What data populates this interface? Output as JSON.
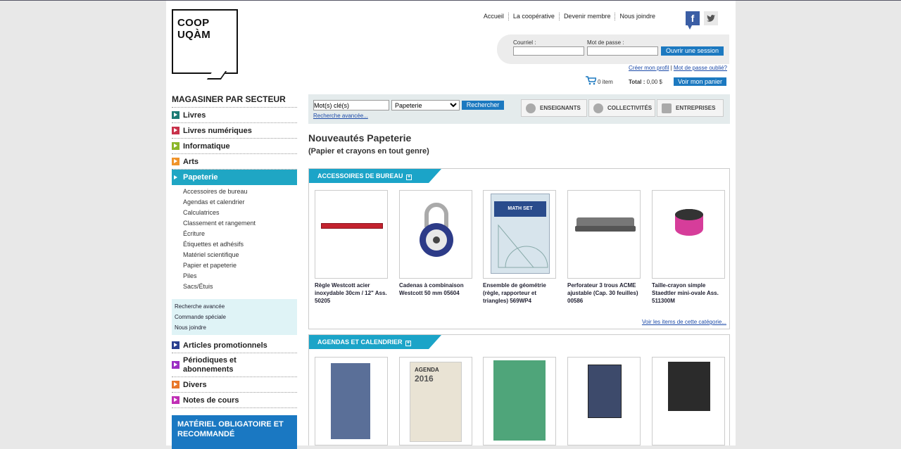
{
  "logo": {
    "line1": "COOP",
    "line2": "UQÀM"
  },
  "topnav": [
    "Accueil",
    "La coopérative",
    "Devenir membre",
    "Nous joindre"
  ],
  "social": {
    "facebook": "f",
    "twitter": "t"
  },
  "login": {
    "email_label": "Courriel :",
    "password_label": "Mot de passe :",
    "submit": "Ouvrir une session"
  },
  "account": {
    "create": "Créer mon profil",
    "sep": "|",
    "forgot": "Mot de passe oublié?"
  },
  "cart": {
    "items": "0 item",
    "total_label": "Total :",
    "total_value": "0,00 $",
    "view": "Voir mon panier"
  },
  "sidebar": {
    "title": "MAGASINER PAR SECTEUR",
    "categories": [
      {
        "label": "Livres",
        "color": "#1c7b74"
      },
      {
        "label": "Livres numériques",
        "color": "#c8314a"
      },
      {
        "label": "Informatique",
        "color": "#8cb629"
      },
      {
        "label": "Arts",
        "color": "#f0942a"
      },
      {
        "label": "Papeterie",
        "color": "#1fa6c4"
      }
    ],
    "subcategories": [
      "Accessoires de bureau",
      "Agendas et calendrier",
      "Calculatrices",
      "Classement et rangement",
      "Écriture",
      "Étiquettes et adhésifs",
      "Matériel scientifique",
      "Papier et papeterie",
      "Piles",
      "Sacs/Étuis"
    ],
    "quicklinks": [
      "Recherche avancée",
      "Commande spéciale",
      "Nous joindre"
    ],
    "categories2": [
      {
        "label": "Articles promotionnels",
        "color": "#2a3f8f"
      },
      {
        "label": "Périodiques et abonnements",
        "color": "#9b2fc4"
      },
      {
        "label": "Divers",
        "color": "#e8772a"
      },
      {
        "label": "Notes de cours",
        "color": "#c02fb5"
      }
    ],
    "mandatory": "MATÉRIEL OBLIGATOIRE ET RECOMMANDÉ"
  },
  "search": {
    "placeholder": "Mot(s) clé(s)",
    "select": "Papeterie",
    "button": "Rechercher",
    "advanced": "Recherche avancée..."
  },
  "segments": [
    "ENSEIGNANTS",
    "COLLECTIVITÉS",
    "ENTREPRISES"
  ],
  "page": {
    "title": "Nouveautés Papeterie",
    "subtitle": "(Papier et crayons en tout genre)"
  },
  "sections": [
    {
      "title": "ACCESSOIRES DE BUREAU",
      "see_all": "Voir les items de cette catégorie...",
      "products": [
        "Règle Westcott acier inoxydable 30cm / 12\" Ass. 50205",
        "Cadenas à combinaison Westcott 50 mm 05604",
        "Ensemble de géométrie (règle, rapporteur et triangles) 569WP4",
        "Perforateur 3 trous ACME ajustable (Cap. 30 feuilles) 00586",
        "Taille-crayon simple Staedtler mini-ovale Ass. 511300M"
      ]
    },
    {
      "title": "AGENDAS ET CALENDRIER",
      "products": [
        "",
        "",
        "",
        "",
        ""
      ]
    }
  ],
  "product_images": {
    "agenda_text": "AGENDA",
    "agenda_year": "2016",
    "math_set": "MATH SET"
  }
}
